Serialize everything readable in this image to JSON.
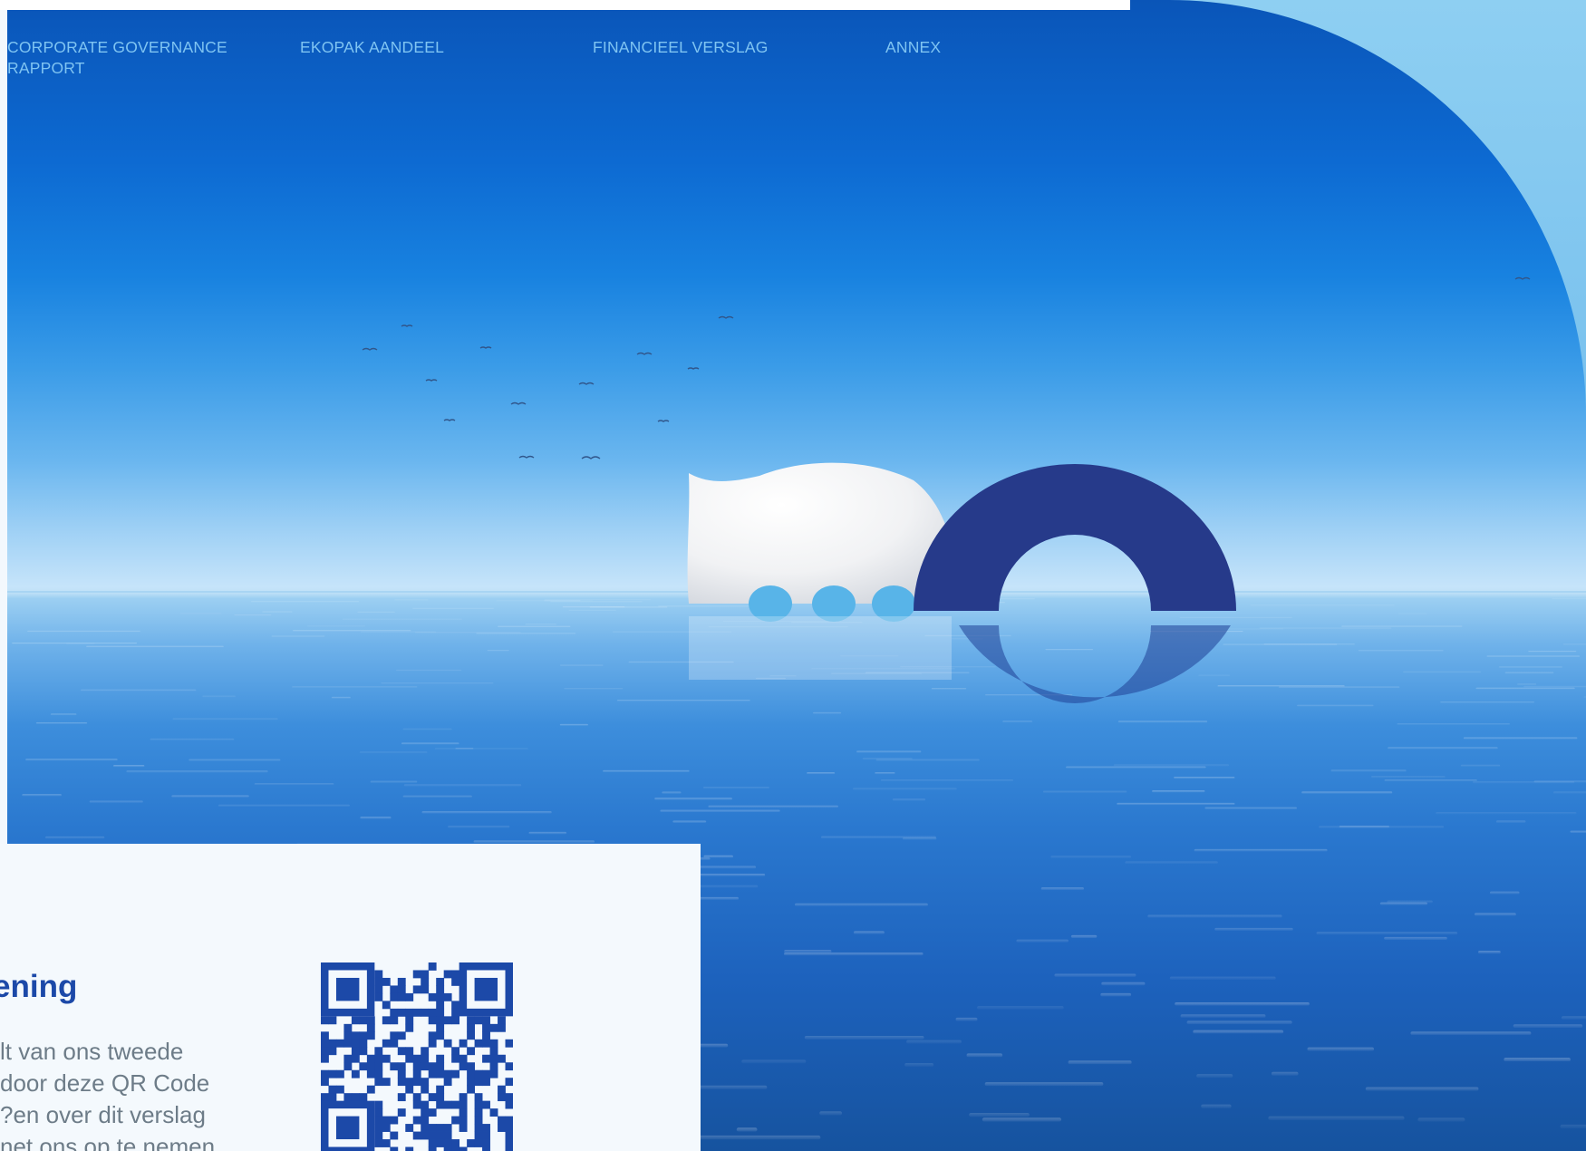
{
  "nav": {
    "items": [
      {
        "label": "CORPORATE GOVERNANCE RAPPORT"
      },
      {
        "label": "EKOPAK AANDEEL"
      },
      {
        "label": "FINANCIEEL VERSLAG"
      },
      {
        "label": "ANNEX"
      }
    ]
  },
  "card": {
    "heading": "ening",
    "lines": [
      "lt van ons tweede",
      "door deze QR Code",
      "en over dit verslag?",
      "net ons op te nemen"
    ]
  },
  "colors": {
    "brand_dark": "#1c49a8",
    "nav_text": "#7fc4f2",
    "logo_navy": "#263a8a",
    "logo_white": "#f2f2f2",
    "logo_dots": "#58b4e8"
  },
  "icons": [
    "ekopak-logo",
    "qr-code-icon",
    "birds"
  ]
}
